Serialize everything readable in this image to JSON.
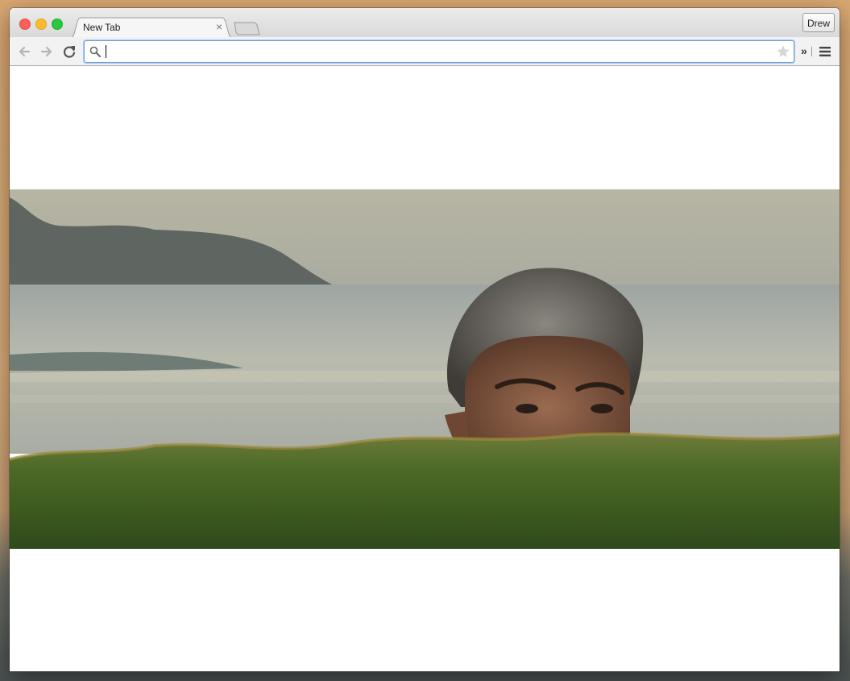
{
  "window": {
    "tab": {
      "title": "New Tab",
      "close_glyph": "×"
    },
    "profile_label": "Drew"
  },
  "toolbar": {
    "omnibox_value": "",
    "overflow_glyph": "»"
  },
  "icons": {
    "back": "back-arrow-icon",
    "forward": "forward-arrow-icon",
    "reload": "reload-icon",
    "search": "search-icon",
    "bookmark": "star-icon",
    "menu": "hamburger-menu-icon"
  },
  "colors": {
    "close": "#fc5f57",
    "minimize": "#fdbc2e",
    "zoom": "#29c840",
    "omnibox_focus": "#6c9fe0"
  },
  "content": {
    "image_subject": "photo-of-man-peeking-over-hedge-by-the-sea"
  }
}
